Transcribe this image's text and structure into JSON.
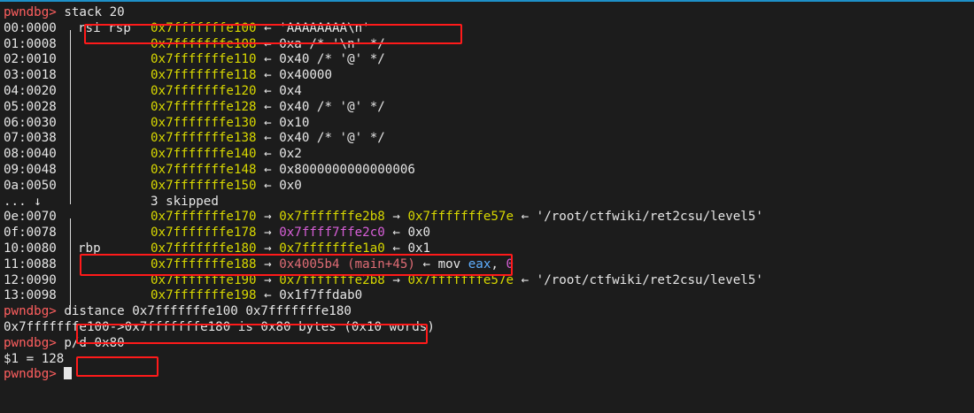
{
  "prompt": "pwndbg>",
  "commands": {
    "stack": "stack 20",
    "distance": "distance 0x7fffffffe100 0x7fffffffe180",
    "print": "p/d 0x80"
  },
  "stack_rows": [
    {
      "offset": "00:0000",
      "reg": "rsi rsp",
      "addr": "0x7fffffffe100",
      "a1": " ← ",
      "val": "'AAAAAAAA\\n'",
      "valc": "w"
    },
    {
      "offset": "01:0008",
      "reg": "",
      "addr": "0x7fffffffe108",
      "a1": " ← ",
      "val": "0xa /* '\\n' */",
      "valc": "w"
    },
    {
      "offset": "02:0010",
      "reg": "",
      "addr": "0x7fffffffe110",
      "a1": " ← ",
      "val": "0x40 /* '@' */",
      "valc": "w"
    },
    {
      "offset": "03:0018",
      "reg": "",
      "addr": "0x7fffffffe118",
      "a1": " ← ",
      "val": "0x40000",
      "valc": "w"
    },
    {
      "offset": "04:0020",
      "reg": "",
      "addr": "0x7fffffffe120",
      "a1": " ← ",
      "val": "0x4",
      "valc": "w"
    },
    {
      "offset": "05:0028",
      "reg": "",
      "addr": "0x7fffffffe128",
      "a1": " ← ",
      "val": "0x40 /* '@' */",
      "valc": "w"
    },
    {
      "offset": "06:0030",
      "reg": "",
      "addr": "0x7fffffffe130",
      "a1": " ← ",
      "val": "0x10",
      "valc": "w"
    },
    {
      "offset": "07:0038",
      "reg": "",
      "addr": "0x7fffffffe138",
      "a1": " ← ",
      "val": "0x40 /* '@' */",
      "valc": "w"
    },
    {
      "offset": "08:0040",
      "reg": "",
      "addr": "0x7fffffffe140",
      "a1": " ← ",
      "val": "0x2",
      "valc": "w"
    },
    {
      "offset": "09:0048",
      "reg": "",
      "addr": "0x7fffffffe148",
      "a1": " ← ",
      "val": "0x8000000000000006",
      "valc": "w"
    },
    {
      "offset": "0a:0050",
      "reg": "",
      "addr": "0x7fffffffe150",
      "a1": " ← ",
      "val": "0x0",
      "valc": "w"
    }
  ],
  "skipped": {
    "marker": "... ↓",
    "text": "3 skipped"
  },
  "stack_rows2": [
    {
      "offset": "0e:0070",
      "reg": "",
      "addr": "0x7fffffffe170",
      "a1": " → ",
      "v1": "0x7fffffffe2b8",
      "v1c": "y",
      "a2": " → ",
      "v2": "0x7fffffffe57e",
      "v2c": "y",
      "a3": " ← ",
      "v3": "'/root/ctfwiki/ret2csu/level5'",
      "v3c": "w"
    },
    {
      "offset": "0f:0078",
      "reg": "",
      "addr": "0x7fffffffe178",
      "a1": " → ",
      "v1": "0x7ffff7ffe2c0",
      "v1c": "m",
      "a2": " ← ",
      "v2": "0x0",
      "v2c": "w",
      "a3": "",
      "v3": "",
      "v3c": "w"
    },
    {
      "offset": "10:0080",
      "reg": "rbp",
      "addr": "0x7fffffffe180",
      "a1": " → ",
      "v1": "0x7fffffffe1a0",
      "v1c": "y",
      "a2": " ← ",
      "v2": "0x1",
      "v2c": "w",
      "a3": "",
      "v3": "",
      "v3c": "w"
    },
    {
      "offset": "11:0088",
      "reg": "",
      "addr": "0x7fffffffe188",
      "a1": " → ",
      "v1": "0x4005b4 (main+45)",
      "v1c": "r",
      "a2": " ← ",
      "v2": "mov",
      "v2c": "w",
      "a3": " ",
      "v3": "eax",
      "v3c": "b",
      "a4": ", ",
      "v4": "0",
      "v4c": "m"
    },
    {
      "offset": "12:0090",
      "reg": "",
      "addr": "0x7fffffffe190",
      "a1": " → ",
      "v1": "0x7fffffffe2b8",
      "v1c": "y",
      "a2": " → ",
      "v2": "0x7fffffffe57e",
      "v2c": "y",
      "a3": " ← ",
      "v3": "'/root/ctfwiki/ret2csu/level5'",
      "v3c": "w"
    },
    {
      "offset": "13:0098",
      "reg": "",
      "addr": "0x7fffffffe198",
      "a1": " ← ",
      "v1": "0x1f7ffdab0",
      "v1c": "w",
      "a2": "",
      "v2": "",
      "v2c": "w",
      "a3": "",
      "v3": "",
      "v3c": "w"
    }
  ],
  "distance_output": "0x7fffffffe100->0x7fffffffe180 is 0x80 bytes (0x10 words)",
  "print_output": "$1 = 128",
  "colors": {
    "background": "#1c1c1c",
    "prompt": "#ff5f5f",
    "address": "#d7d700",
    "highlight_box": "#ff1a1a"
  }
}
